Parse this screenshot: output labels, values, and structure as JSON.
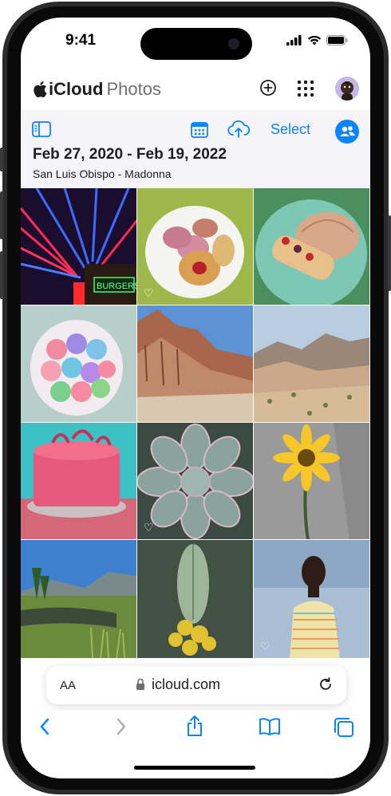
{
  "status": {
    "time": "9:41"
  },
  "header": {
    "brand": "iCloud",
    "app": "Photos"
  },
  "toolbar": {
    "select_label": "Select",
    "date_range": "Feb 27, 2020 - Feb 19, 2022",
    "places": "San Luis Obispo - Madonna"
  },
  "grid": {
    "photos": [
      {
        "subject": "neon burgers sign",
        "favorite": false
      },
      {
        "subject": "sweet pastries on plate",
        "favorite": true
      },
      {
        "subject": "conchas and eclair",
        "favorite": false
      },
      {
        "subject": "colorful macarons",
        "favorite": false
      },
      {
        "subject": "red rock canyon",
        "favorite": false
      },
      {
        "subject": "desert hills",
        "favorite": false
      },
      {
        "subject": "pink frosted cake",
        "favorite": false
      },
      {
        "subject": "succulent plant",
        "favorite": true
      },
      {
        "subject": "yellow gerbera flower",
        "favorite": false
      },
      {
        "subject": "mountain lake landscape",
        "favorite": false
      },
      {
        "subject": "mullein flower stalk",
        "favorite": false
      },
      {
        "subject": "portrait of man",
        "favorite": true
      }
    ]
  },
  "browser": {
    "text_size_label": "AA",
    "url": "icloud.com"
  },
  "colors": {
    "accent": "#0a84ff",
    "toolbar_bg": "#f5f5f7"
  },
  "icons": [
    "apple-logo",
    "add-icon",
    "apps-grid-icon",
    "sidebar-icon",
    "calendar-icon",
    "upload-cloud-icon",
    "people-icon",
    "lock-icon",
    "reload-icon",
    "back-icon",
    "forward-icon",
    "share-icon",
    "bookmarks-icon",
    "tabs-icon",
    "heart-icon"
  ]
}
